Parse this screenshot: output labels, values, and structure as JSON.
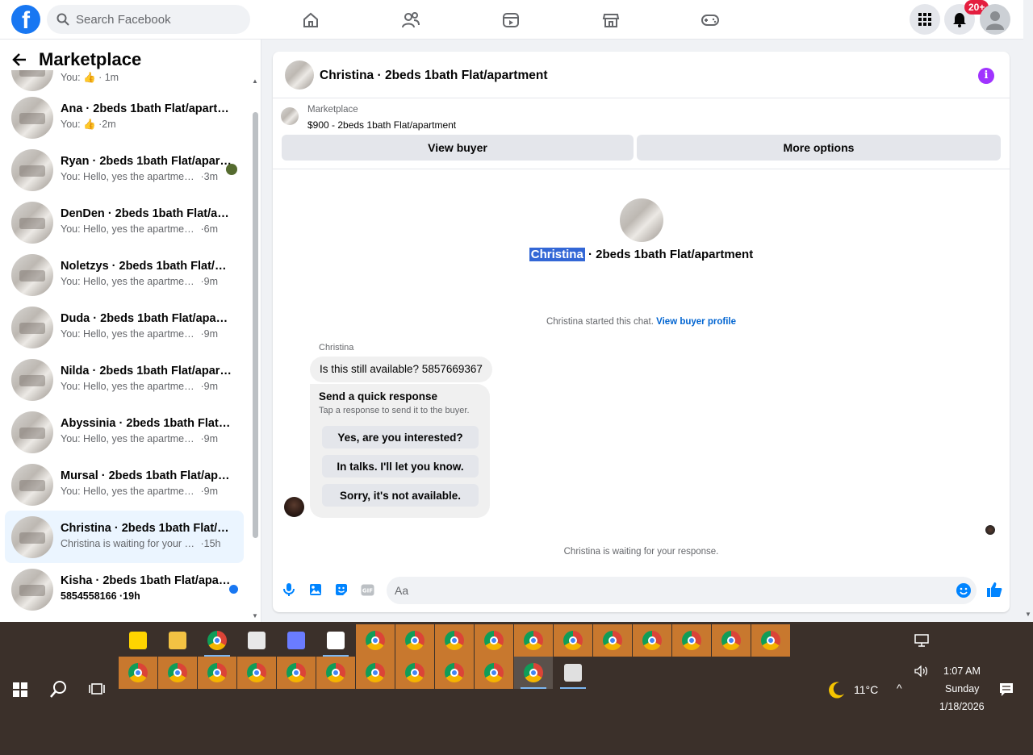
{
  "topbar": {
    "logo": "f",
    "search_placeholder": "Search Facebook",
    "nav_icons": [
      "home-icon",
      "friends-icon",
      "watch-icon",
      "marketplace-icon",
      "gaming-icon"
    ],
    "notifications_badge": "20+"
  },
  "sidebar": {
    "title": "Marketplace",
    "partial_top": {
      "sub": "You: 👍 · 1m"
    },
    "conversations": [
      {
        "title": "Ana · 2beds 1bath Flat/apartment",
        "msg": "You: 👍",
        "time": "2m"
      },
      {
        "title": "Ryan · 2beds 1bath Flat/apart...",
        "msg": "You: Hello, yes the apartment is...",
        "time": "3m"
      },
      {
        "title": "DenDen · 2beds 1bath Flat/apar...",
        "msg": "You: Hello, yes the apartment is sti...",
        "time": "6m"
      },
      {
        "title": "Noletzys · 2beds 1bath Flat/apar...",
        "msg": "You: Hello, yes the apartment is sti...",
        "time": "9m"
      },
      {
        "title": "Duda · 2beds 1bath Flat/apartm...",
        "msg": "You: Hello, yes the apartment is sti...",
        "time": "9m"
      },
      {
        "title": "Nilda · 2beds 1bath Flat/apartm...",
        "msg": "You: Hello, yes the apartment is sti...",
        "time": "9m"
      },
      {
        "title": "Abyssinia · 2beds 1bath Flat/apa...",
        "msg": "You: Hello, yes the apartment is sti...",
        "time": "9m"
      },
      {
        "title": "Mursal · 2beds 1bath Flat/apart...",
        "msg": "You: Hello, yes the apartment is sti...",
        "time": "9m"
      },
      {
        "title": "Christina · 2beds 1bath Flat/apar...",
        "msg": "Christina is waiting for your respo...",
        "time": "15h"
      },
      {
        "title": "Kisha · 2beds 1bath Flat/apart...",
        "msg": "5854558166",
        "time": "19h"
      }
    ]
  },
  "chat": {
    "title": "Christina · 2beds 1bath Flat/apartment",
    "listing": {
      "source": "Marketplace",
      "price_title": "$900 - 2beds 1bath Flat/apartment"
    },
    "buttons": {
      "view_buyer": "View buyer",
      "more_options": "More options"
    },
    "intro": {
      "name": "Christina",
      "rest": " · 2beds 1bath Flat/apartment"
    },
    "started_text": "Christina started this chat.",
    "view_profile": "View buyer profile",
    "sender": "Christina",
    "message": "Is this still available? 5857669367",
    "quick": {
      "title": "Send a quick response",
      "subtitle": "Tap a response to send it to the buyer.",
      "options": [
        "Yes, are you interested?",
        "In talks. I'll let you know.",
        "Sorry, it's not available."
      ]
    },
    "waiting": "Christina is waiting for your response.",
    "input_placeholder": "Aa"
  },
  "taskbar": {
    "weather": "11°C",
    "time": "1:07 AM",
    "day": "Sunday",
    "date": "1/18/2026"
  },
  "colors": {
    "brand": "#1877f2",
    "taskbar": "#3b302a",
    "chrome_tile": "#c8782e",
    "badge": "#e41e3f"
  }
}
